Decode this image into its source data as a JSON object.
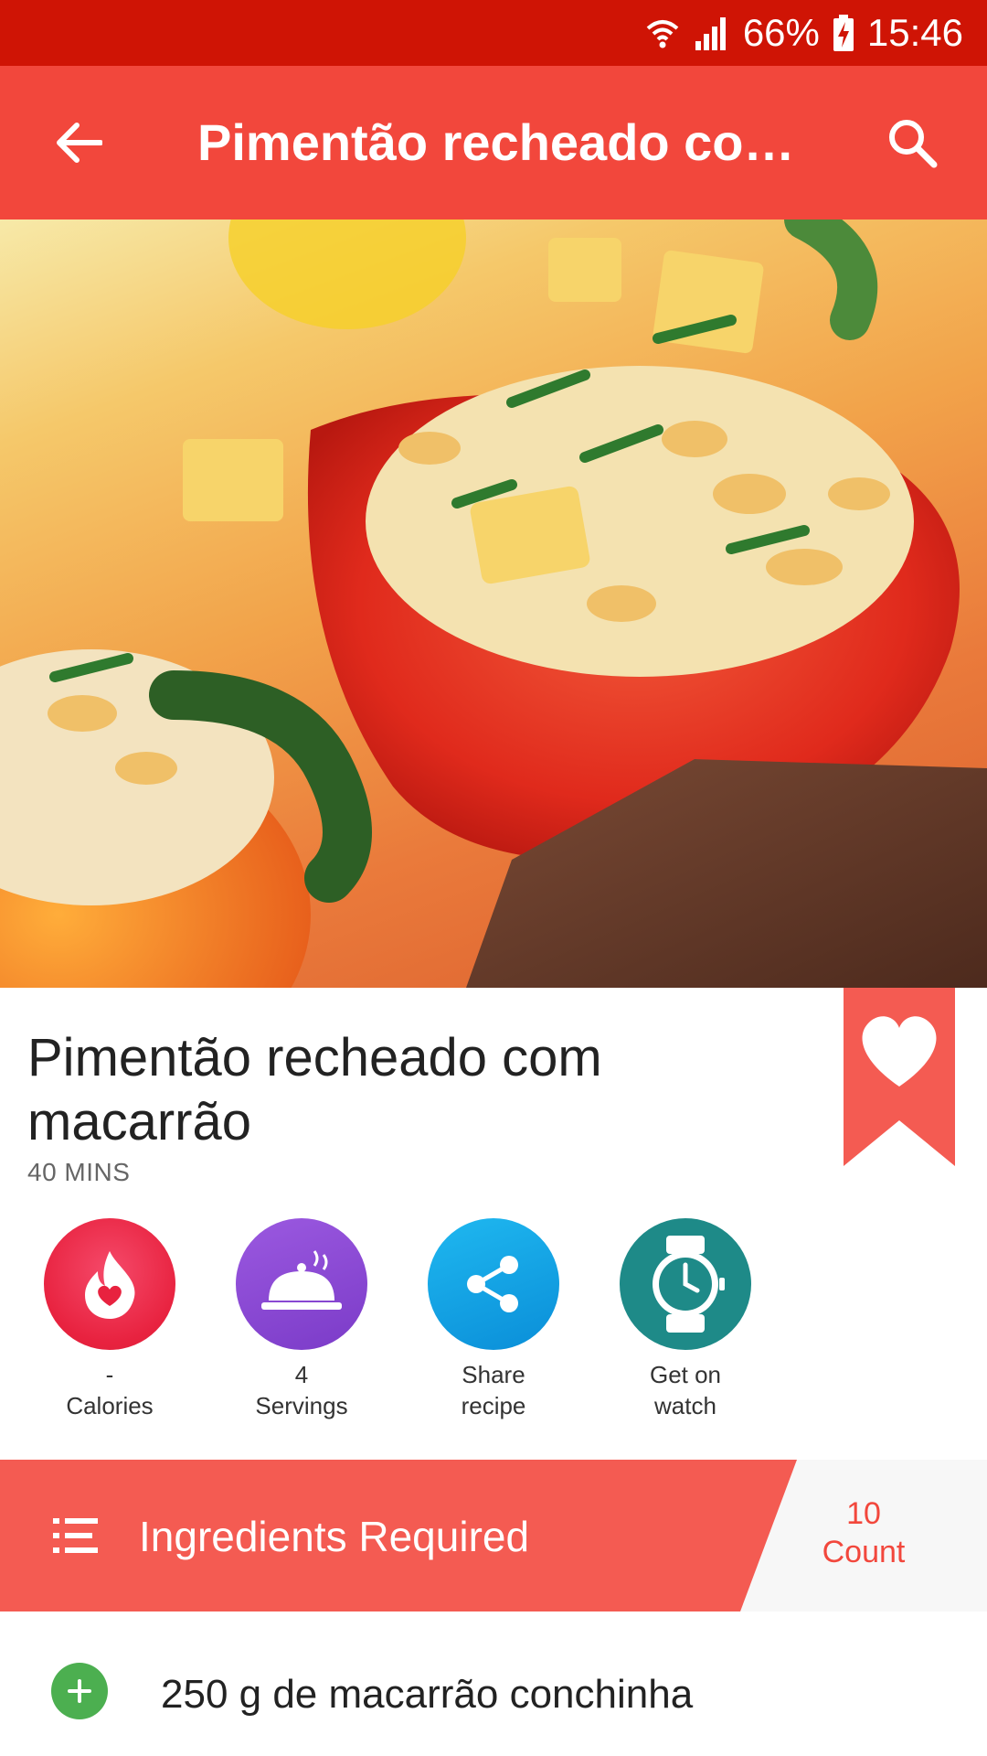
{
  "status_bar": {
    "battery": "66%",
    "time": "15:46"
  },
  "app_bar": {
    "title": "Pimentão recheado co…"
  },
  "recipe": {
    "title": "Pimentão recheado com macarrão",
    "time": "40 MINS"
  },
  "actions": [
    {
      "value": "-",
      "label": "Calories",
      "icon": "flame-heart-icon"
    },
    {
      "value": "4",
      "label": "Servings",
      "icon": "cloche-icon"
    },
    {
      "value": "Share",
      "label": "recipe",
      "icon": "share-icon"
    },
    {
      "value": "Get on",
      "label": "watch",
      "icon": "watch-icon"
    }
  ],
  "ingredients_bar": {
    "label": "Ingredients Required",
    "count_value": "10",
    "count_label": "Count"
  },
  "ingredients": [
    "250 g de macarrão conchinha"
  ],
  "colors": {
    "status_bar": "#cf1405",
    "app_bar": "#f2473c",
    "accent": "#f2473c",
    "add_button": "#4caf50"
  }
}
